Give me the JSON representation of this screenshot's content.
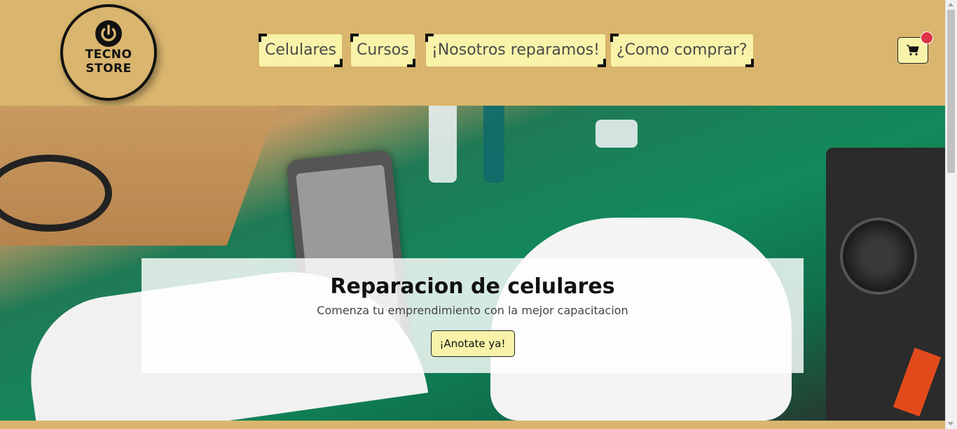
{
  "brand": {
    "line1": "TECNO",
    "line2": "STORE",
    "icon": "power-icon"
  },
  "nav": {
    "items": [
      {
        "label": "Celulares"
      },
      {
        "label": "Cursos"
      },
      {
        "label": "¡Nosotros reparamos!"
      },
      {
        "label": "¿Como comprar?"
      }
    ]
  },
  "cart": {
    "icon": "shopping-cart-icon",
    "badge_color": "#dc3545"
  },
  "hero": {
    "title": "Reparacion de celulares",
    "subtitle": "Comenza tu emprendimiento con la mejor capacitacion",
    "cta_label": "¡Anotate ya!"
  },
  "colors": {
    "header_bg": "#d9b56e",
    "button_bg": "#f8f3a9",
    "badge": "#dc3545"
  }
}
